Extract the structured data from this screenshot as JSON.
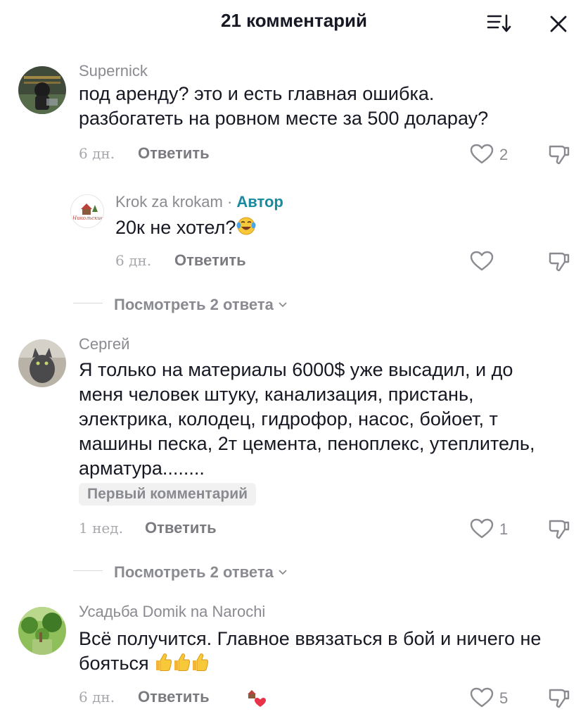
{
  "header": {
    "title": "21 комментарий"
  },
  "comments": [
    {
      "author": "Supernick",
      "text1": "под аренду? это и есть главная ошибка.",
      "text2": "разбогатеть на ровном месте за 500 доларау?",
      "time": "6 дн.",
      "reply_label": "Ответить",
      "likes": "2"
    },
    {
      "author": "Krok za krokam",
      "author_sep": " · ",
      "author_tag": "Автор",
      "text": "20к не хотел?",
      "time": "6 дн.",
      "reply_label": "Ответить"
    },
    {
      "author": "Сергей",
      "text1": "Я только на материалы 6000$ уже высадил, и до",
      "text2": "меня человек штуку, канализация, пристань,",
      "text3": "электрика, колодец, гидрофор, насос, бойоет, т",
      "text4": "машины песка, 2т цемента, пеноплекс, утеплитель,",
      "text5": "арматура........",
      "badge": "Первый комментарий",
      "time": "1 нед.",
      "reply_label": "Ответить",
      "likes": "1"
    },
    {
      "author": "Усадьба Domik na Narochi",
      "text1": "Всё получится. Главное ввязаться в бой и ничего не",
      "text2": "бояться",
      "time": "6 дн.",
      "reply_label": "Ответить",
      "likes": "5"
    }
  ],
  "view_replies": [
    {
      "label": "Посмотреть 2 ответа"
    },
    {
      "label": "Посмотреть 2 ответа"
    }
  ],
  "icons": {
    "sort": "sort-icon",
    "close": "close-icon",
    "like": "heart-outline-icon",
    "dislike": "thumbs-down-icon",
    "laugh": "tears-of-joy-emoji",
    "thumbs_up": "thumbs-up-emoji"
  },
  "colors": {
    "author_tag": "#1a8a9e",
    "text": "#161823",
    "muted": "#8a8b91"
  }
}
